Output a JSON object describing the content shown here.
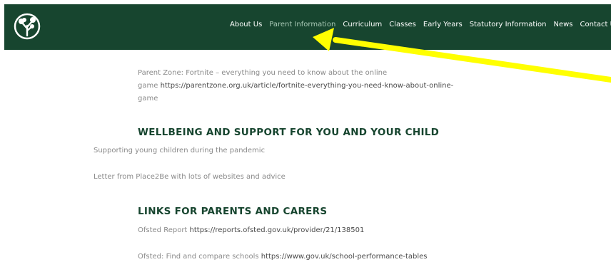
{
  "caption": {
    "text": "highlights the Parent Information navigation item on the school website landing page"
  },
  "header": {
    "nav": [
      {
        "label": "About Us",
        "active": false
      },
      {
        "label": "Parent Information",
        "active": true
      },
      {
        "label": "Curriculum",
        "active": false
      },
      {
        "label": "Classes",
        "active": false
      },
      {
        "label": "Early Years",
        "active": false
      },
      {
        "label": "Statutory Information",
        "active": false
      },
      {
        "label": "News",
        "active": false
      },
      {
        "label": "Contact Us",
        "active": false
      }
    ],
    "colors": {
      "nav_bg": "#17452f",
      "nav_text": "#ffffff",
      "active_nav_text": "#a9c9b6"
    }
  },
  "main": {
    "fortnite": {
      "line1": "Parent Zone: Fortnite – everything you need to know about the online",
      "line2_prefix": "game ",
      "link_text": "https://parentzone.org.uk/article/fortnite-everything-you-need-know-about-online-",
      "line3": "game"
    },
    "wellbeing_heading": "WELLBEING AND SUPPORT FOR YOU AND YOUR CHILD",
    "wellbeing_items": [
      "Supporting young children during the pandemic",
      "Letter from Place2Be with lots of websites and advice"
    ],
    "links_heading": "LINKS FOR PARENTS AND CARERS",
    "ofsted_report": {
      "label": "Ofsted Report ",
      "url": "https://reports.ofsted.gov.uk/provider/21/138501"
    },
    "ofsted_compare": {
      "label": "Ofsted: Find and compare schools ",
      "url": "https://www.gov.uk/school-performance-tables"
    },
    "colors": {
      "heading": "#17452f",
      "body_text": "#8a8a8a",
      "link_text": "#4a4a4a"
    }
  },
  "annotation": {
    "arrow_color": "#ffff00",
    "points_to": "Parent Information"
  }
}
